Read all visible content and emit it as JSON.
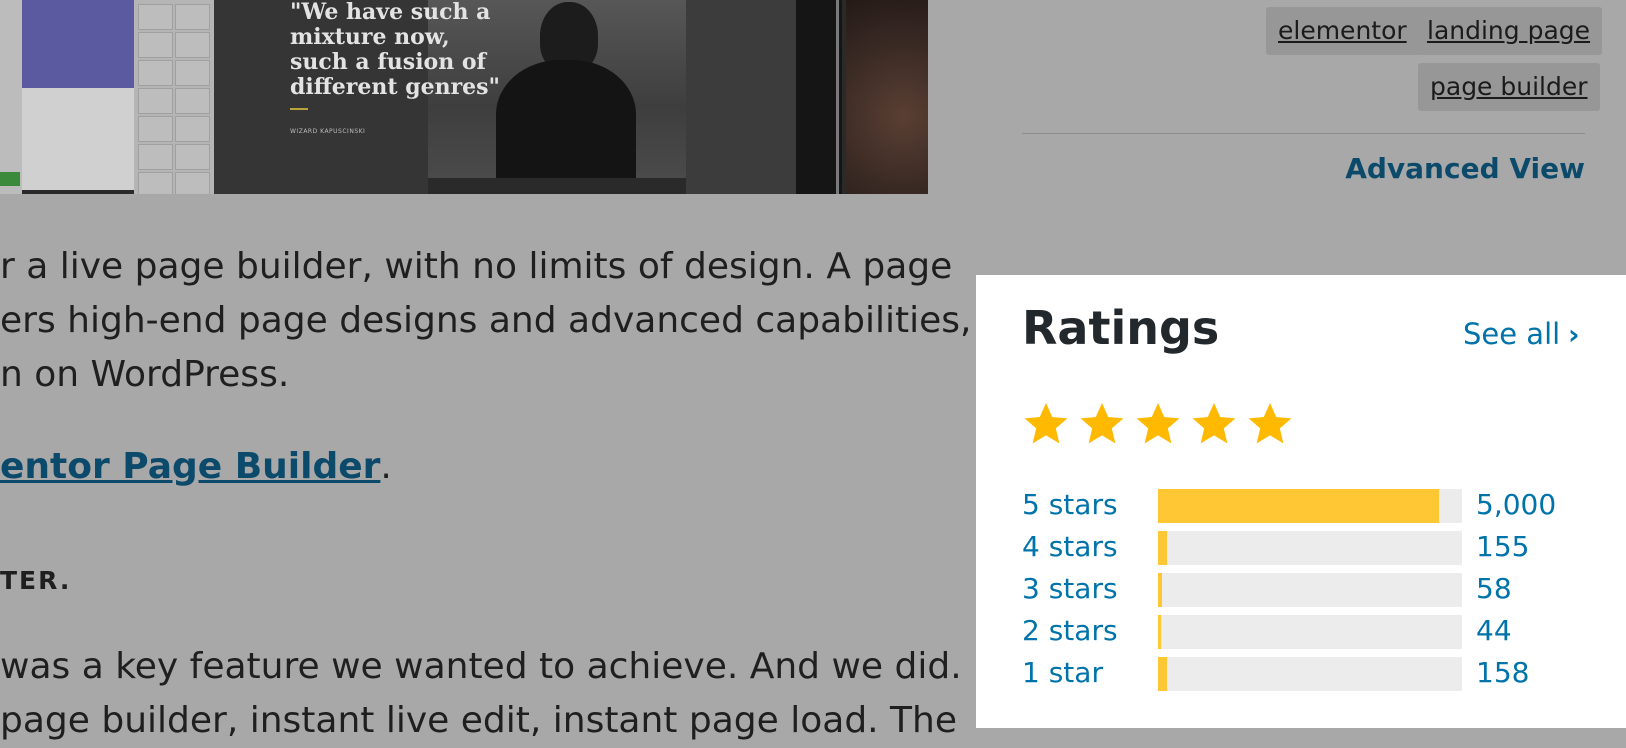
{
  "hero": {
    "quote": "\"We have such a mixture now, such a fusion of different genres\"",
    "quote_author": "WIZARD KAPUSCINSKI"
  },
  "article": {
    "p1": "r a live page builder, with no limits of design. A page",
    "p2": "ers high-end page designs and advanced capabilities,",
    "p3": "n on WordPress.",
    "link_text": "entor Page Builder",
    "link_suffix": ".",
    "heading": "TER.",
    "p4": "was a key feature we wanted to achieve. And we did. In-",
    "p5": " page builder, instant live edit, instant page load. The"
  },
  "tags": [
    "elementor",
    "landing page",
    "page builder"
  ],
  "advanced_view": "Advanced View",
  "ratings": {
    "title": "Ratings",
    "see_all": "See all",
    "average_stars": 5,
    "star_color": "#ffb900",
    "rows": [
      {
        "label": "5 stars",
        "count": "5,000",
        "fraction": 0.925
      },
      {
        "label": "4 stars",
        "count": "155",
        "fraction": 0.03
      },
      {
        "label": "3 stars",
        "count": "58",
        "fraction": 0.012
      },
      {
        "label": "2 stars",
        "count": "44",
        "fraction": 0.009
      },
      {
        "label": "1 star",
        "count": "158",
        "fraction": 0.03
      }
    ]
  },
  "colors": {
    "link": "#0073aa",
    "bar_fill": "#ffc733",
    "bar_track": "#ececec"
  }
}
